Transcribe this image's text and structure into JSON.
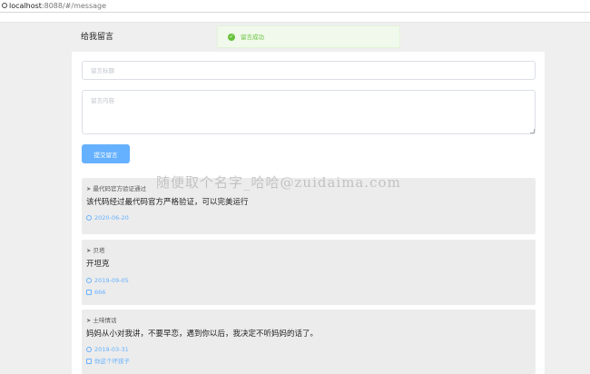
{
  "browser": {
    "host": "localhost",
    "rest": ":8088/#/message"
  },
  "header": {
    "title": "给我留言"
  },
  "toast": {
    "icon": "check-circle-icon",
    "message": "留言成功"
  },
  "form": {
    "title_placeholder": "留言标题",
    "content_placeholder": "留言内容",
    "submit_label": "提交留言"
  },
  "messages": [
    {
      "author": "最代码官方验证通过",
      "content": "该代码经过最代码官方严格验证，可以完美运行",
      "date": "2020-06-20"
    },
    {
      "author": "贝塔",
      "content": "开坦克",
      "date": "2019-09-05",
      "reply": "666"
    },
    {
      "author": "土味情话",
      "content": "妈妈从小对我讲，不要早恋，遇到你以后，我决定不听妈妈的话了。",
      "date": "2019-03-31",
      "reply": "你这个坏孩子"
    }
  ],
  "watermark": "随便取个名字_哈哈@zuidaima.com",
  "colors": {
    "accent": "#66b1ff",
    "success": "#67c23a",
    "success_bg": "#f0f9eb",
    "page_bg": "#efefef",
    "item_bg": "#ececec"
  }
}
